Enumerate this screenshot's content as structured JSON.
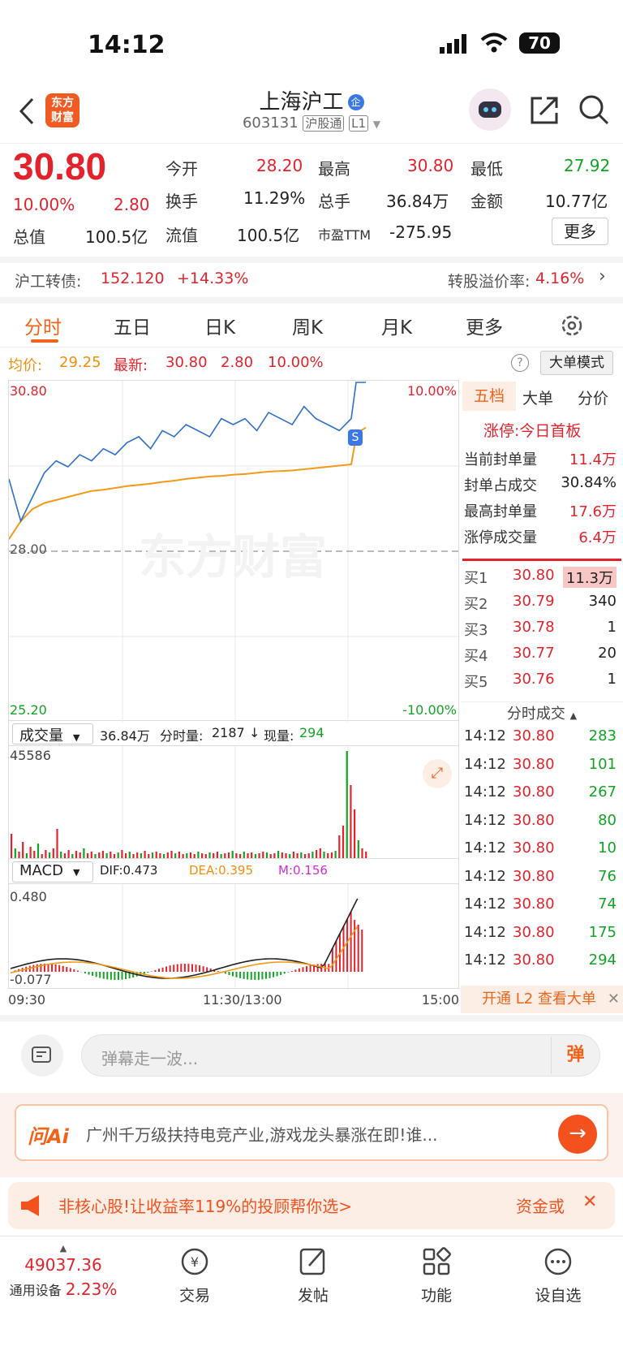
{
  "status": {
    "time": "14:12",
    "battery": "70"
  },
  "header": {
    "title": "上海沪工",
    "badge": "企",
    "code": "603131",
    "tag1": "沪股通",
    "tag2": "L1",
    "logo_l1": "东方",
    "logo_l2": "财富"
  },
  "quote": {
    "price": "30.80",
    "pct": "10.00%",
    "chg": "2.80",
    "rows": [
      [
        {
          "l": "今开",
          "v": "28.20",
          "c": "red"
        },
        {
          "l": "最高",
          "v": "30.80",
          "c": "red"
        },
        {
          "l": "最低",
          "v": "27.92",
          "c": "green"
        }
      ],
      [
        {
          "l": "换手",
          "v": "11.29%",
          "c": "dark"
        },
        {
          "l": "总手",
          "v": "36.84万",
          "c": "dark"
        },
        {
          "l": "金额",
          "v": "10.77亿",
          "c": "dark"
        }
      ],
      [
        {
          "l": "总值",
          "v": "100.5亿",
          "c": "dark"
        },
        {
          "l": "流值",
          "v": "100.5亿",
          "c": "dark"
        },
        {
          "l": "市盈TTM",
          "v": "-275.95",
          "c": "dark"
        }
      ]
    ],
    "more": "更多"
  },
  "bond": {
    "label": "沪工转债:",
    "price": "152.120",
    "pct": "+14.33%",
    "premium_label": "转股溢价率:",
    "premium": "4.16%"
  },
  "tabs": [
    "分时",
    "五日",
    "日K",
    "周K",
    "月K",
    "更多"
  ],
  "avg": {
    "label": "均价:",
    "value": "29.25",
    "latest_label": "最新:",
    "latest": "30.80",
    "chg": "2.80",
    "pct": "10.00%",
    "mode_btn": "大单模式"
  },
  "chart_labels": {
    "top_left": "30.80",
    "top_right": "10.00%",
    "mid": "28.00",
    "bot_left": "25.20",
    "bot_right": "-10.00%",
    "watermark": "东方财富",
    "s_marker": "S"
  },
  "volume": {
    "title": "成交量",
    "total": "36.84万",
    "fs_label": "分时量:",
    "fs_value": "2187",
    "now_label": "现量:",
    "now_value": "294",
    "max": "45586"
  },
  "macd": {
    "title": "MACD",
    "dif": "DIF:0.473",
    "dea": "DEA:0.395",
    "m": "M:0.156",
    "top": "0.480",
    "bottom": "-0.077"
  },
  "time_axis": {
    "start": "09:30",
    "mid": "11:30/13:00",
    "end": "15:00"
  },
  "side": {
    "tabs": [
      "五档",
      "大单",
      "分价"
    ],
    "limit_label": "涨停:",
    "limit_text": "今日首板",
    "stats": [
      {
        "l": "当前封单量",
        "v": "11.4万"
      },
      {
        "l": "封单占成交",
        "v": "30.84%"
      },
      {
        "l": "最高封单量",
        "v": "17.6万"
      },
      {
        "l": "涨停成交量",
        "v": "6.4万"
      }
    ],
    "bids": [
      {
        "l": "买1",
        "p": "30.80",
        "v": "11.3万"
      },
      {
        "l": "买2",
        "p": "30.79",
        "v": "340"
      },
      {
        "l": "买3",
        "p": "30.78",
        "v": "1"
      },
      {
        "l": "买4",
        "p": "30.77",
        "v": "20"
      },
      {
        "l": "买5",
        "p": "30.76",
        "v": "1"
      }
    ],
    "trades_title": "分时成交",
    "trades": [
      {
        "t": "14:12",
        "p": "30.80",
        "v": "283"
      },
      {
        "t": "14:12",
        "p": "30.80",
        "v": "101"
      },
      {
        "t": "14:12",
        "p": "30.80",
        "v": "267"
      },
      {
        "t": "14:12",
        "p": "30.80",
        "v": "80"
      },
      {
        "t": "14:12",
        "p": "30.80",
        "v": "10"
      },
      {
        "t": "14:12",
        "p": "30.80",
        "v": "76"
      },
      {
        "t": "14:12",
        "p": "30.80",
        "v": "74"
      },
      {
        "t": "14:12",
        "p": "30.80",
        "v": "175"
      },
      {
        "t": "14:12",
        "p": "30.80",
        "v": "294"
      }
    ],
    "l2": "开通 L2 查看大单"
  },
  "danmu": {
    "placeholder": "弹幕走一波...",
    "btn": "弹"
  },
  "ai": {
    "logo": "问Ai",
    "text": "广州千万级扶持电竞产业,游戏龙头暴涨在即!谁..."
  },
  "ad": {
    "text": "非核心股!让收益率119%的投顾帮你选>",
    "right": "资金或"
  },
  "bottom": {
    "index": "49037.36",
    "sector": "通用设备",
    "sector_pct": "2.23%",
    "items": [
      "交易",
      "发帖",
      "功能",
      "设自选"
    ]
  },
  "chart_data": {
    "type": "line",
    "price_series": [
      29.2,
      28.5,
      28.9,
      29.3,
      29.5,
      29.4,
      29.6,
      29.5,
      29.7,
      29.6,
      29.8,
      29.9,
      29.7,
      30.0,
      29.9,
      30.1,
      30.0,
      29.9,
      30.2,
      30.1,
      30.2,
      30.0,
      30.3,
      30.2,
      30.1,
      30.4,
      30.2,
      30.1,
      30.0,
      30.2,
      30.8,
      30.8,
      30.8
    ],
    "avg_series": [
      28.2,
      28.5,
      28.7,
      28.8,
      28.85,
      28.9,
      28.95,
      29.0,
      29.02,
      29.05,
      29.08,
      29.1,
      29.12,
      29.15,
      29.17,
      29.2,
      29.22,
      29.24,
      29.25,
      29.27,
      29.28,
      29.3,
      29.32,
      29.33,
      29.34,
      29.36,
      29.38,
      29.4,
      29.42,
      29.44,
      29.9,
      30.0,
      30.05
    ],
    "ylim": [
      25.2,
      30.8
    ]
  }
}
